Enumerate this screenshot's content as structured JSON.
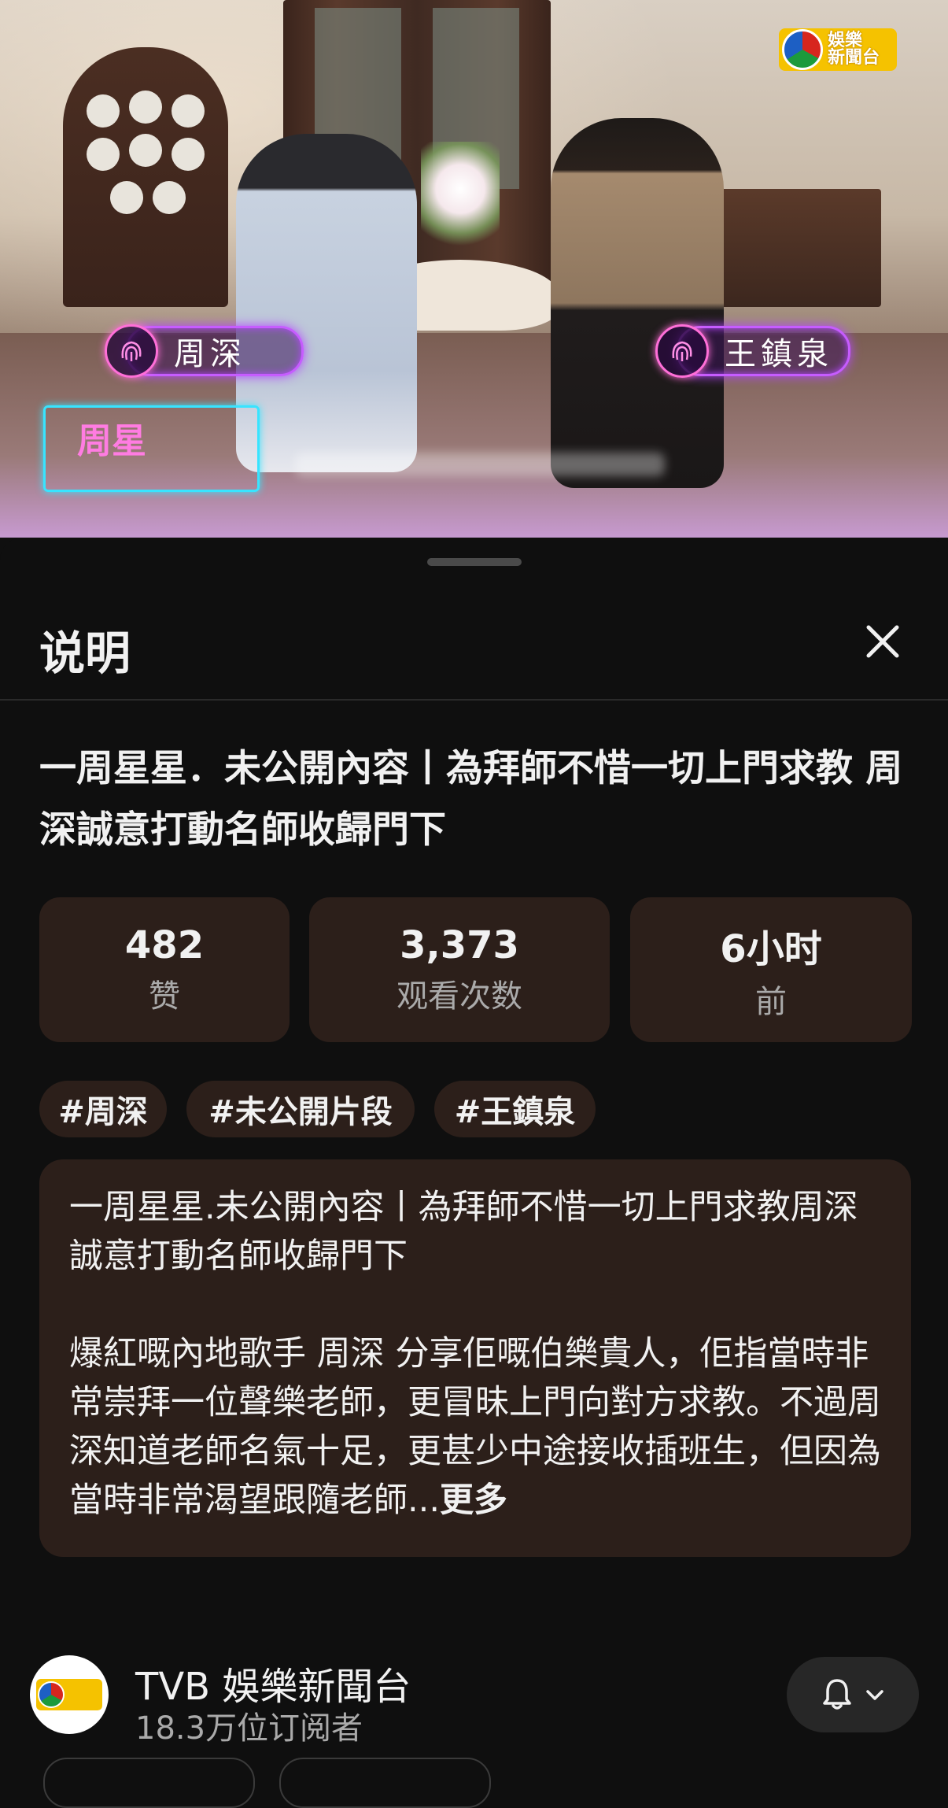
{
  "video": {
    "guest_name": "周深",
    "host_name": "王鎮泉",
    "channel_logo_text": "娛樂\n新聞台",
    "show_logo_text": "周星"
  },
  "sheet": {
    "title": "说明",
    "video_title": "一周星星．未公開內容丨為拜師不惜一切上門求教 周深誠意打動名師收歸門下",
    "stats": [
      {
        "value": "482",
        "label": "赞"
      },
      {
        "value": "3,373",
        "label": "观看次数"
      },
      {
        "value": "6小时",
        "label": "前"
      }
    ],
    "tags": [
      "#周深",
      "#未公開片段",
      "#王鎮泉"
    ],
    "description": {
      "para1": "一周星星.未公開內容丨為拜師不惜一切上門求教周深誠意打動名師收歸門下",
      "para2": "爆紅嘅內地歌手 周深 分享佢嘅伯樂貴人，佢指當時非常崇拜一位聲樂老師，更冒昧上門向對方求教。不過周深知道老師名氣十足，更甚少中途接收插班生，但因為當時非常渴望跟隨老師...",
      "more": "更多"
    },
    "channel": {
      "name": "TVB 娛樂新聞台",
      "subscribers": "18.3万位订阅者"
    }
  }
}
